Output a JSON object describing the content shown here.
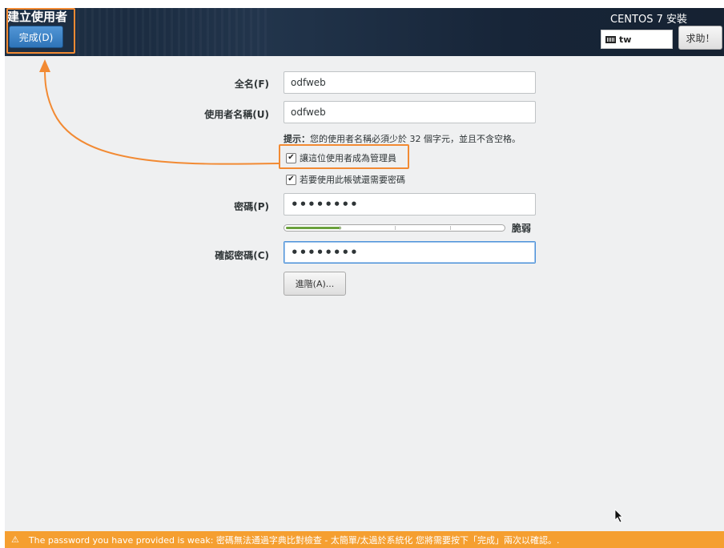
{
  "header": {
    "title": "建立使用者",
    "done_label": "完成(D)",
    "install_title": "CENTOS 7 安裝",
    "keyboard_layout": "tw",
    "help_label": "求助！"
  },
  "form": {
    "fullname_label": "全名(F)",
    "fullname_value": "odfweb",
    "username_label": "使用者名稱(U)",
    "username_value": "odfweb",
    "hint_prefix": "提示：",
    "hint_text": "您的使用者名稱必須少於 32 個字元，並且不含空格。",
    "admin_checkbox_label": "讓這位使用者成為管理員",
    "admin_checked": true,
    "require_password_label": "若要使用此帳號還需要密碼",
    "require_password_checked": true,
    "password_label": "密碼(P)",
    "password_value": "••••••••",
    "strength_label": "脆弱",
    "strength_fraction": 0.25,
    "confirm_label": "確認密碼(C)",
    "confirm_value": "••••••••",
    "advanced_label": "進階(A)..."
  },
  "warning": {
    "text": "The password you have provided is weak: 密碼無法通過字典比對檢查 - 太簡單/太過於系統化 您將需要按下「完成」兩次以確認。."
  },
  "colors": {
    "accent": "#f28a33",
    "warning_bg": "#f59f30",
    "strength_fill": "#6aa03c"
  }
}
